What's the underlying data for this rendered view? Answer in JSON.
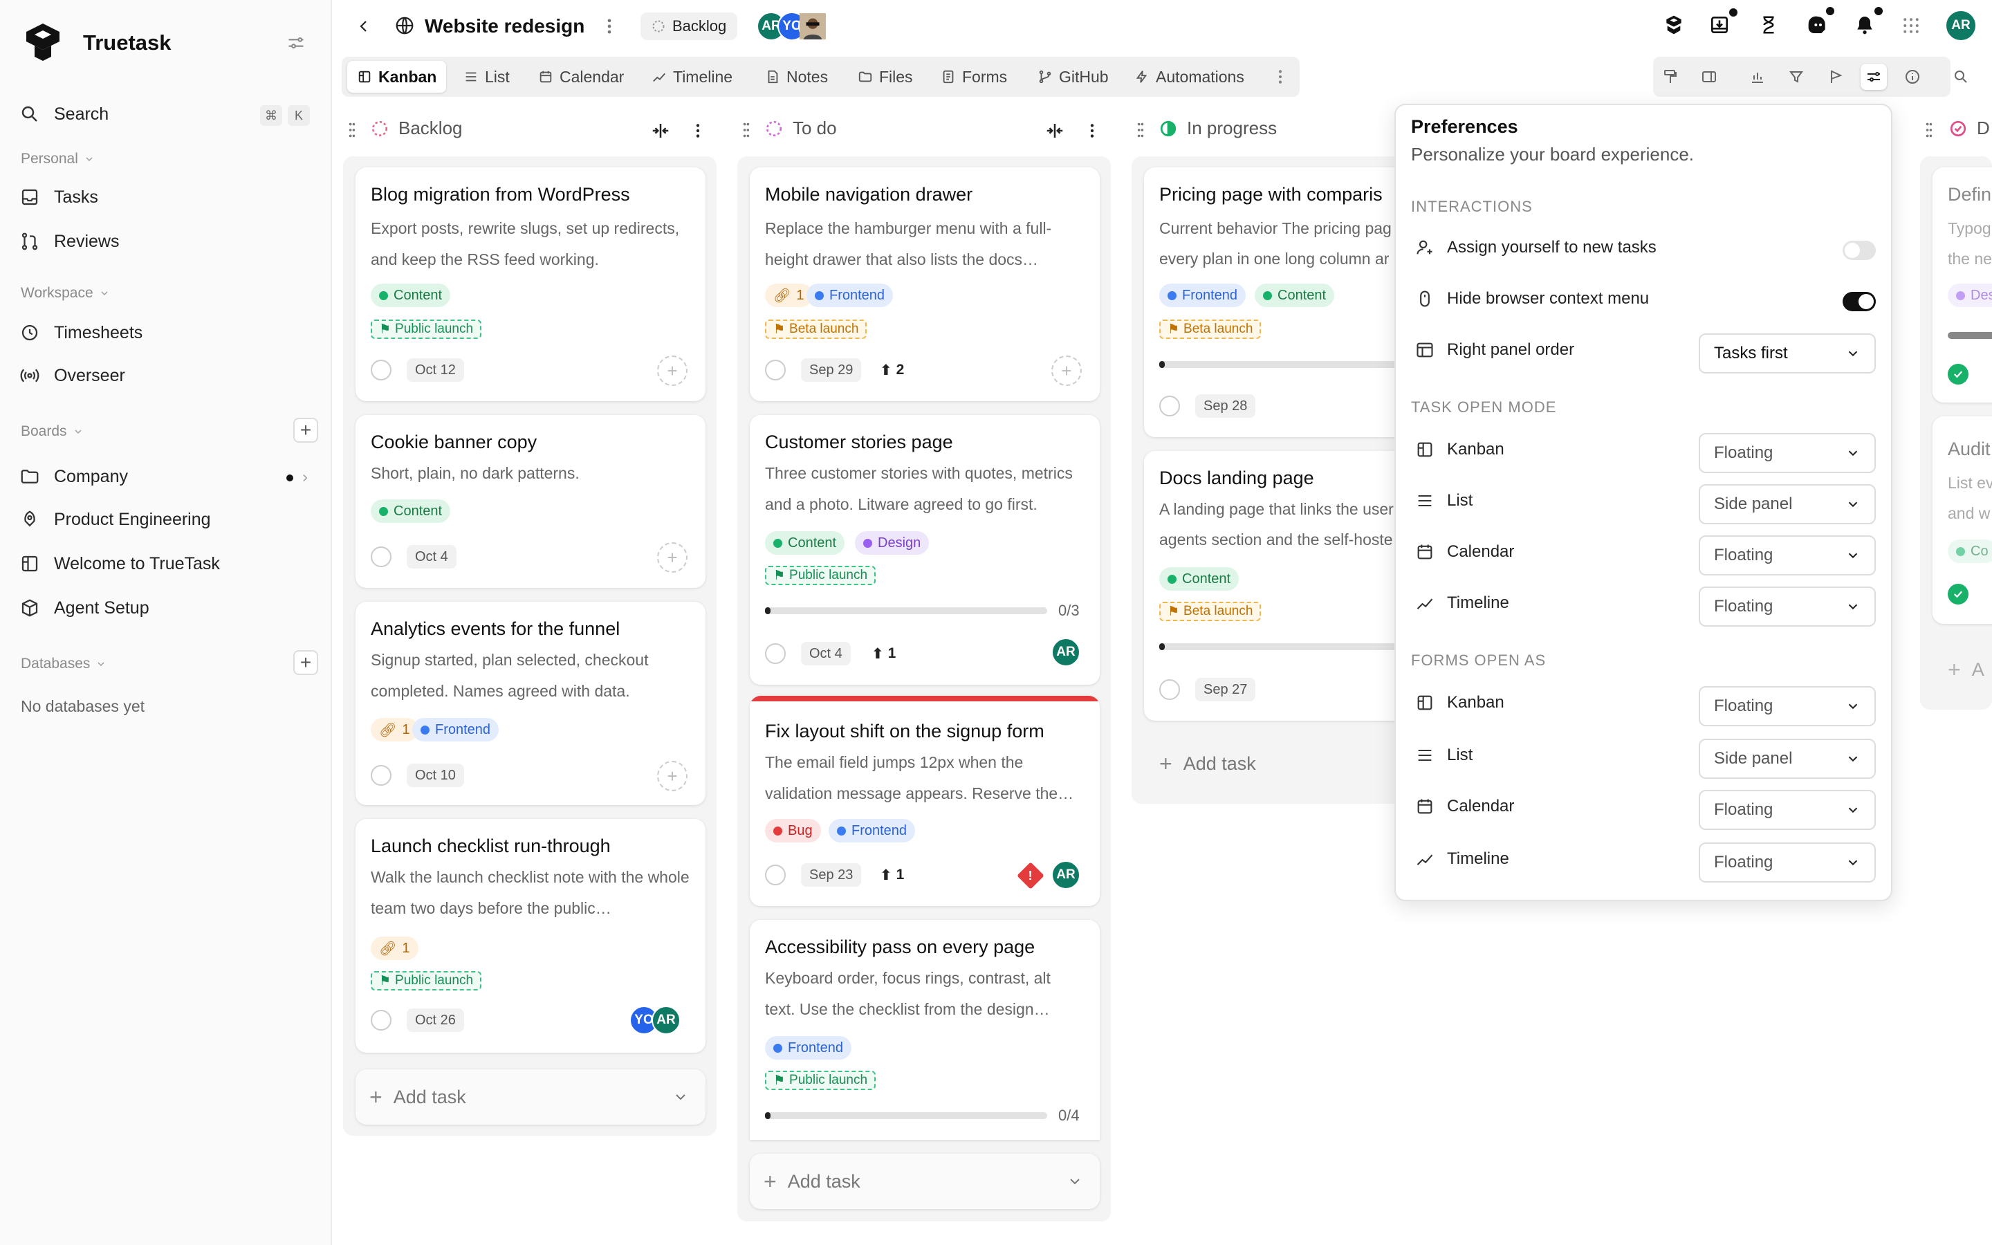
{
  "app": {
    "name": "Truetask"
  },
  "sidebar": {
    "search": {
      "label": "Search",
      "shortcut_mod": "⌘",
      "shortcut_key": "K"
    },
    "personal": {
      "label": "Personal",
      "items": [
        {
          "label": "Tasks"
        },
        {
          "label": "Reviews"
        }
      ]
    },
    "workspace": {
      "label": "Workspace",
      "items": [
        {
          "label": "Timesheets"
        },
        {
          "label": "Overseer"
        }
      ]
    },
    "boards": {
      "label": "Boards",
      "items": [
        {
          "label": "Company"
        },
        {
          "label": "Product Engineering"
        },
        {
          "label": "Welcome to TrueTask"
        },
        {
          "label": "Agent Setup"
        }
      ]
    },
    "databases": {
      "label": "Databases",
      "empty": "No databases yet"
    }
  },
  "header": {
    "board_title": "Website redesign",
    "status_chip": "Backlog",
    "members": [
      {
        "initials": "AR",
        "color": "#0f7a63"
      },
      {
        "initials": "YO",
        "color": "#2563eb"
      }
    ],
    "user_initials": "AR",
    "tabs": [
      {
        "label": "Kanban",
        "icon": "kanban-icon"
      },
      {
        "label": "List",
        "icon": "list-icon"
      },
      {
        "label": "Calendar",
        "icon": "calendar-icon"
      },
      {
        "label": "Timeline",
        "icon": "timeline-icon"
      },
      {
        "label": "Notes",
        "icon": "notes-icon"
      },
      {
        "label": "Files",
        "icon": "folder-icon"
      },
      {
        "label": "Forms",
        "icon": "forms-icon"
      },
      {
        "label": "GitHub",
        "icon": "branch-icon"
      },
      {
        "label": "Automations",
        "icon": "bolt-icon"
      }
    ]
  },
  "columns": [
    {
      "name": "Backlog",
      "add_task": "Add task",
      "cards": [
        {
          "title": "Blog migration from WordPress",
          "desc": "Export posts, rewrite slugs, set up redirects, and keep the RSS feed working.",
          "tags": [
            "Content"
          ],
          "milestone": "Public launch",
          "date": "Oct 12"
        },
        {
          "title": "Cookie banner copy",
          "desc": "Short, plain, no dark patterns.",
          "tags": [
            "Content"
          ],
          "date": "Oct 4"
        },
        {
          "title": "Analytics events for the funnel",
          "desc": "Signup started, plan selected, checkout completed. Names agreed with data.",
          "link_count": "1",
          "tags": [
            "Frontend"
          ],
          "date": "Oct 10"
        },
        {
          "title": "Launch checklist run-through",
          "desc": "Walk the launch checklist note with the whole team two days before the public…",
          "link_count": "1",
          "milestone": "Public launch",
          "date": "Oct 26",
          "assignees": [
            "YO",
            "AR"
          ]
        }
      ]
    },
    {
      "name": "To do",
      "add_task": "Add task",
      "cards": [
        {
          "title": "Mobile navigation drawer",
          "desc": "Replace the hamburger menu with a full-height drawer that also lists the docs…",
          "link_count": "1",
          "tags": [
            "Frontend"
          ],
          "milestone": "Beta launch",
          "date": "Sep 29",
          "priority": "2"
        },
        {
          "title": "Customer stories page",
          "desc": "Three customer stories with quotes, metrics and a photo. Litware agreed to go first.",
          "tags": [
            "Content",
            "Design"
          ],
          "milestone": "Public launch",
          "progress": "0/3",
          "progress_value": 0.02,
          "date": "Oct 4",
          "priority": "1",
          "assignees": [
            "AR"
          ]
        },
        {
          "title": "Fix layout shift on the signup form",
          "desc": "The email field jumps 12px when the validation message appears. Reserve the…",
          "tags": [
            "Bug",
            "Frontend"
          ],
          "date": "Sep 23",
          "priority": "1",
          "urgent": "!",
          "assignees": [
            "AR"
          ]
        },
        {
          "title": "Accessibility pass on every page",
          "desc": "Keyboard order, focus rings, contrast, alt text. Use the checklist from the design…",
          "tags": [
            "Frontend"
          ],
          "milestone": "Public launch",
          "progress": "0/4",
          "progress_value": 0.02
        }
      ]
    },
    {
      "name": "In progress",
      "add_task": "Add task",
      "cards": [
        {
          "title": "Pricing page with comparis",
          "desc_1": "Current behavior The pricing pag",
          "desc_2": "every plan in one long column ar",
          "tags": [
            "Frontend",
            "Content"
          ],
          "milestone": "Beta launch",
          "date": "Sep 28"
        },
        {
          "title": "Docs landing page",
          "desc_1": "A landing page that links the user",
          "desc_2": "agents section and the self-hoste",
          "tags": [
            "Content"
          ],
          "milestone": "Beta launch",
          "date": "Sep 27"
        }
      ]
    },
    {
      "name": "D",
      "peek": {
        "title_1": "Defin",
        "desc_1": "Typog",
        "desc_2": "the ne",
        "tag_1": "Des",
        "title_2": "Audit",
        "desc_3": "List ev",
        "desc_4": "and w",
        "tag_2": "Co",
        "add": "A"
      }
    }
  ],
  "preferences": {
    "title": "Preferences",
    "subtitle": "Personalize your board experience.",
    "interactions": {
      "label": "INTERACTIONS",
      "assign_self": {
        "label": "Assign yourself to new tasks",
        "enabled": false
      },
      "hide_context_menu": {
        "label": "Hide browser context menu",
        "enabled": true
      },
      "right_panel_order": {
        "label": "Right panel order",
        "value": "Tasks first"
      }
    },
    "task_open_mode": {
      "label": "TASK OPEN MODE",
      "rows": [
        {
          "label": "Kanban",
          "value": "Floating"
        },
        {
          "label": "List",
          "value": "Side panel"
        },
        {
          "label": "Calendar",
          "value": "Floating"
        },
        {
          "label": "Timeline",
          "value": "Floating"
        }
      ]
    },
    "forms_open_as": {
      "label": "FORMS OPEN AS",
      "rows": [
        {
          "label": "Kanban",
          "value": "Floating"
        },
        {
          "label": "List",
          "value": "Side panel"
        },
        {
          "label": "Calendar",
          "value": "Floating"
        },
        {
          "label": "Timeline",
          "value": "Floating"
        }
      ]
    }
  },
  "colors": {
    "accent": "#0f7a63",
    "bug_bar": "#e43c3c",
    "avatar_blue": "#2563eb"
  }
}
